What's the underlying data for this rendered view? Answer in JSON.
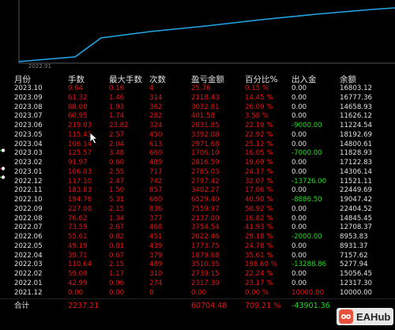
{
  "chart": {
    "xlabel": "2022.01",
    "line_color": "#22a6e8",
    "points": [
      [
        24,
        78
      ],
      [
        95,
        72
      ],
      [
        128,
        48
      ],
      [
        190,
        40
      ],
      [
        260,
        33
      ],
      [
        330,
        25
      ],
      [
        400,
        18
      ],
      [
        470,
        12
      ],
      [
        500,
        10
      ]
    ]
  },
  "columns": {
    "month": "月份",
    "hands": "手数",
    "max_hands": "最大手数",
    "count": "次数",
    "pnl": "盈亏金额",
    "pct": "百分比%",
    "inout": "出入金",
    "balance": "余额"
  },
  "rows": [
    {
      "month": "2023.10",
      "hands": "0.64",
      "max_hands": "0.16",
      "count": "4",
      "pnl": "25.76",
      "pct": "0.15 %",
      "inout": "0.00",
      "balance": "16803.12",
      "inout_color": "wht"
    },
    {
      "month": "2023.09",
      "hands": "61.32",
      "max_hands": "1.46",
      "count": "314",
      "pnl": "2118.43",
      "pct": "14.45 %",
      "inout": "0.00",
      "balance": "16777.36",
      "inout_color": "wht"
    },
    {
      "month": "2023.08",
      "hands": "88.00",
      "max_hands": "1.93",
      "count": "362",
      "pnl": "3032.81",
      "pct": "26.09 %",
      "inout": "0.00",
      "balance": "14658.93",
      "inout_color": "wht"
    },
    {
      "month": "2023.07",
      "hands": "60.95",
      "max_hands": "1.74",
      "count": "282",
      "pnl": "401.58",
      "pct": "3.58 %",
      "inout": "0.00",
      "balance": "11626.12",
      "inout_color": "wht"
    },
    {
      "month": "2023.06",
      "hands": "219.03",
      "max_hands": "23.82",
      "count": "324",
      "pnl": "2031.85",
      "pct": "22.10 %",
      "inout": "-9000.00",
      "balance": "11224.54",
      "inout_color": "green"
    },
    {
      "month": "2023.05",
      "hands": "115.43",
      "max_hands": "2.57",
      "count": "450",
      "pnl": "3392.08",
      "pct": "22.92 %",
      "inout": "0.00",
      "balance": "18192.69",
      "inout_color": "wht"
    },
    {
      "month": "2023.04",
      "hands": "106.14",
      "max_hands": "2.04",
      "count": "613",
      "pnl": "2971.68",
      "pct": "25.12 %",
      "inout": "0.00",
      "balance": "14800.61",
      "inout_color": "wht"
    },
    {
      "month": "2023.03",
      "hands": "125.57",
      "max_hands": "3.48",
      "count": "660",
      "pnl": "1706.10",
      "pct": "16.05 %",
      "inout": "-7000.00",
      "balance": "11828.93",
      "inout_color": "green"
    },
    {
      "month": "2023.02",
      "hands": "91.97",
      "max_hands": "0.60",
      "count": "489",
      "pnl": "2816.59",
      "pct": "19.69 %",
      "inout": "0.00",
      "balance": "17122.83",
      "inout_color": "wht"
    },
    {
      "month": "2023.01",
      "hands": "106.03",
      "max_hands": "2.55",
      "count": "717",
      "pnl": "2785.03",
      "pct": "24.17 %",
      "inout": "0.00",
      "balance": "14306.14",
      "inout_color": "wht"
    },
    {
      "month": "2022.12",
      "hands": "117.10",
      "max_hands": "2.47",
      "count": "742",
      "pnl": "2797.42",
      "pct": "32.07 %",
      "inout": "-13726.00",
      "balance": "11521.11",
      "inout_color": "green"
    },
    {
      "month": "2022.11",
      "hands": "183.83",
      "max_hands": "1.50",
      "count": "857",
      "pnl": "3402.27",
      "pct": "17.86 %",
      "inout": "0.00",
      "balance": "22449.69",
      "inout_color": "wht"
    },
    {
      "month": "2022.10",
      "hands": "194.76",
      "max_hands": "5.31",
      "count": "660",
      "pnl": "6529.40",
      "pct": "40.90 %",
      "inout": "-8886.50",
      "balance": "19047.42",
      "inout_color": "green"
    },
    {
      "month": "2022.09",
      "hands": "227.00",
      "max_hands": "2.15",
      "count": "836",
      "pnl": "7559.97",
      "pct": "50.92 %",
      "inout": "0.00",
      "balance": "22404.52",
      "inout_color": "wht"
    },
    {
      "month": "2022.08",
      "hands": "76.62",
      "max_hands": "1.34",
      "count": "377",
      "pnl": "2137.00",
      "pct": "16.82 %",
      "inout": "0.00",
      "balance": "14845.45",
      "inout_color": "wht"
    },
    {
      "month": "2022.07",
      "hands": "73.59",
      "max_hands": "2.67",
      "count": "468",
      "pnl": "3754.54",
      "pct": "41.93 %",
      "inout": "0.00",
      "balance": "12708.37",
      "inout_color": "wht"
    },
    {
      "month": "2022.06",
      "hands": "55.61",
      "max_hands": "0.82",
      "count": "451",
      "pnl": "2022.46",
      "pct": "29.18 %",
      "inout": "-2000.00",
      "balance": "8953.83",
      "inout_color": "green"
    },
    {
      "month": "2022.05",
      "hands": "49.19",
      "max_hands": "0.81",
      "count": "439",
      "pnl": "1773.75",
      "pct": "24.78 %",
      "inout": "0.00",
      "balance": "8931.37",
      "inout_color": "wht"
    },
    {
      "month": "2022.04",
      "hands": "39.71",
      "max_hands": "0.67",
      "count": "379",
      "pnl": "1879.68",
      "pct": "35.61 %",
      "inout": "0.00",
      "balance": "7157.62",
      "inout_color": "wht"
    },
    {
      "month": "2022.03",
      "hands": "110.64",
      "max_hands": "2.15",
      "count": "489",
      "pnl": "3510.35",
      "pct": "198.60 %",
      "inout": "-13288.86",
      "balance": "5277.94",
      "inout_color": "green"
    },
    {
      "month": "2022.02",
      "hands": "59.09",
      "max_hands": "1.17",
      "count": "310",
      "pnl": "2739.15",
      "pct": "22.24 %",
      "inout": "0.00",
      "balance": "15056.45",
      "inout_color": "wht"
    },
    {
      "month": "2022.01",
      "hands": "42.99",
      "max_hands": "0.96",
      "count": "274",
      "pnl": "2317.30",
      "pct": "23.17 %",
      "inout": "0.00",
      "balance": "12317.30",
      "inout_color": "wht"
    },
    {
      "month": "2021.12",
      "hands": "0.00",
      "max_hands": "0.00",
      "count": "0",
      "pnl": "0.00",
      "pct": "0.00 %",
      "inout": "10000.00",
      "balance": "10000.00",
      "inout_color": "red"
    }
  ],
  "total": {
    "label": "合计",
    "hands": "2237.21",
    "pnl": "60704.48",
    "pct": "709.21 %",
    "inout": "-43901.36"
  },
  "watermark": {
    "text": "EAHub",
    "logo_color": "#e8503a"
  }
}
